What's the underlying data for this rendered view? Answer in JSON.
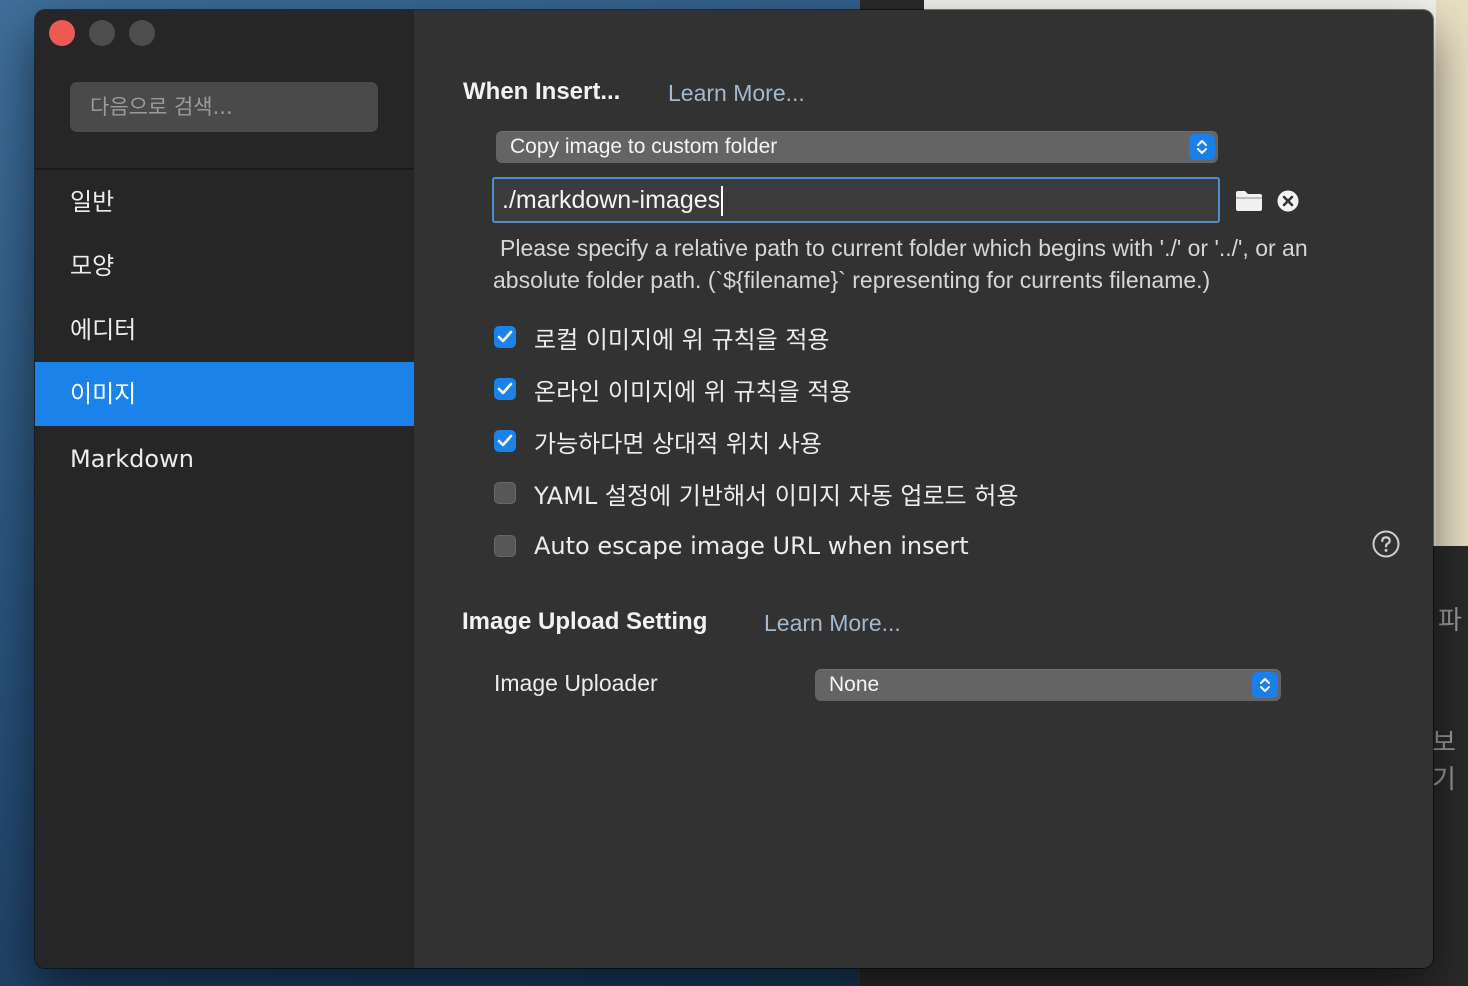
{
  "background": {
    "side_text_1": "파",
    "side_text_2": "보기"
  },
  "sidebar": {
    "search_placeholder": "다음으로 검색...",
    "items": [
      {
        "label": "일반"
      },
      {
        "label": "모양"
      },
      {
        "label": "에디터"
      },
      {
        "label": "이미지",
        "active": true
      },
      {
        "label": "Markdown"
      }
    ]
  },
  "insert": {
    "title": "When Insert...",
    "learn_more": "Learn More...",
    "action_select": "Copy image to custom folder",
    "path_value": "./markdown-images",
    "hint": "Please specify a relative path to current folder which begins with './' or '../', or an absolute folder path. (`${filename}` representing for currents filename.)",
    "options": [
      {
        "label": "로컬 이미지에 위 규칙을 적용",
        "checked": true
      },
      {
        "label": "온라인 이미지에 위 규칙을 적용",
        "checked": true
      },
      {
        "label": "가능하다면 상대적 위치 사용",
        "checked": true
      },
      {
        "label": "YAML 설정에 기반해서 이미지 자동 업로드 허용",
        "checked": false
      },
      {
        "label": "Auto escape image URL when insert",
        "checked": false
      }
    ]
  },
  "upload": {
    "title": "Image Upload Setting",
    "learn_more": "Learn More...",
    "uploader_label": "Image Uploader",
    "uploader_value": "None"
  },
  "colors": {
    "accent": "#1a82e8",
    "close": "#ed5a54",
    "link": "#a3b9cf"
  },
  "icons": [
    "folder-icon",
    "clear-icon",
    "help-icon",
    "chevron-updown-icon",
    "checkmark-icon"
  ]
}
